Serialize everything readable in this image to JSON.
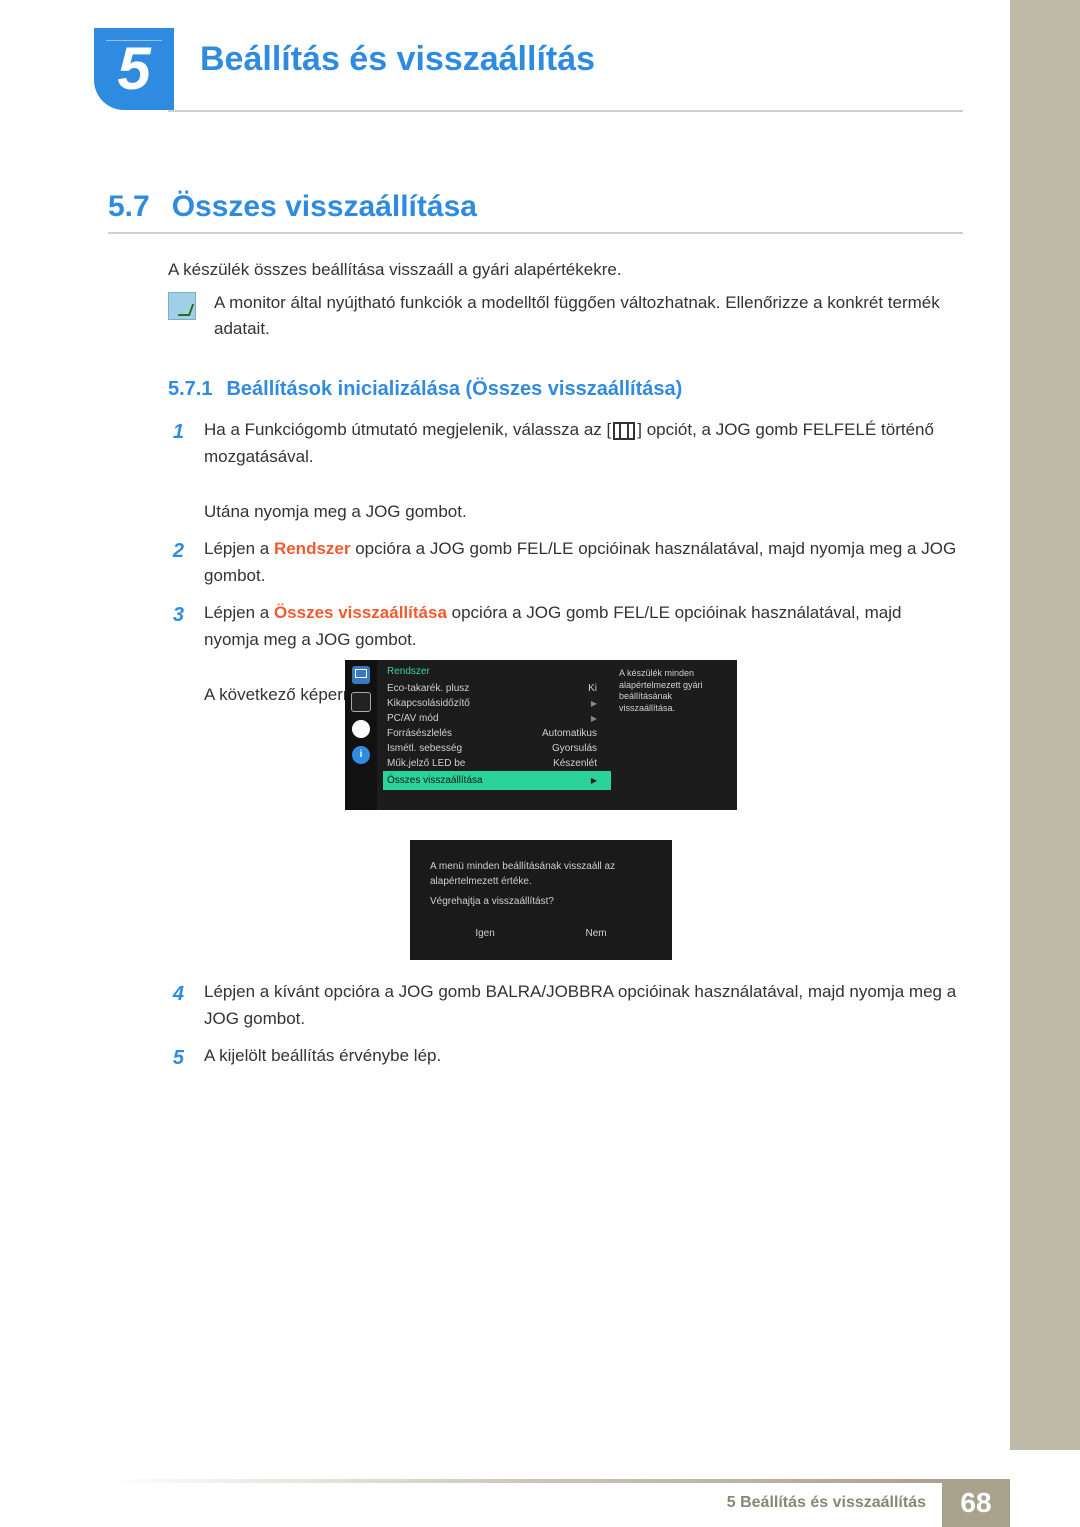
{
  "chapter": {
    "number": "5",
    "title": "Beállítás és visszaállítás"
  },
  "section": {
    "number": "5.7",
    "title": "Összes visszaállítása"
  },
  "intro": "A készülék összes beállítása visszaáll a gyári alapértékekre.",
  "note": "A monitor által nyújtható funkciók a modelltől függően változhatnak. Ellenőrizze a konkrét termék adatait.",
  "subsection": {
    "number": "5.7.1",
    "title": "Beállítások inicializálása (Összes visszaállítása)"
  },
  "steps": {
    "s1a": "Ha a Funkciógomb útmutató megjelenik, válassza az [",
    "s1b": "] opciót, a JOG gomb FELFELÉ történő mozgatásával.",
    "s1c": "Utána nyomja meg a JOG gombot.",
    "s2a": "Lépjen a ",
    "s2hl": "Rendszer",
    "s2b": " opcióra a JOG gomb FEL/LE opcióinak használatával, majd nyomja meg a JOG gombot.",
    "s3a": "Lépjen a ",
    "s3hl": "Összes visszaállítása",
    "s3b": " opcióra a JOG gomb FEL/LE opcióinak használatával, majd nyomja meg a JOG gombot.",
    "s3c": "A következő képernyő jelenik meg.",
    "s4": "Lépjen a kívánt opcióra a JOG gomb BALRA/JOBBRA opcióinak használatával, majd nyomja meg a JOG gombot.",
    "s5": "A kijelölt beállítás érvénybe lép."
  },
  "stepnums": {
    "n1": "1",
    "n2": "2",
    "n3": "3",
    "n4": "4",
    "n5": "5"
  },
  "osd1": {
    "title": "Rendszer",
    "rows": [
      {
        "label": "Eco-takarék. plusz",
        "value": "Ki"
      },
      {
        "label": "Kikapcsolásidőzítő",
        "value": "▶"
      },
      {
        "label": "PC/AV mód",
        "value": "▶"
      },
      {
        "label": "Forrásészlelés",
        "value": "Automatikus"
      },
      {
        "label": "Ismétl. sebesség",
        "value": "Gyorsulás"
      },
      {
        "label": "Műk.jelző LED be",
        "value": "Készenlét"
      }
    ],
    "selected": {
      "label": "Összes visszaállítása",
      "value": "▶"
    },
    "desc": "A készülék minden alapértelmezett gyári beállításának visszaállítása."
  },
  "osd2": {
    "line1": "A menü minden beállításának visszaáll az alapértelmezett értéke.",
    "line2": "Végrehajtja a visszaállítást?",
    "yes": "Igen",
    "no": "Nem"
  },
  "footer": {
    "crumb": "5 Beállítás és visszaállítás",
    "page": "68"
  }
}
